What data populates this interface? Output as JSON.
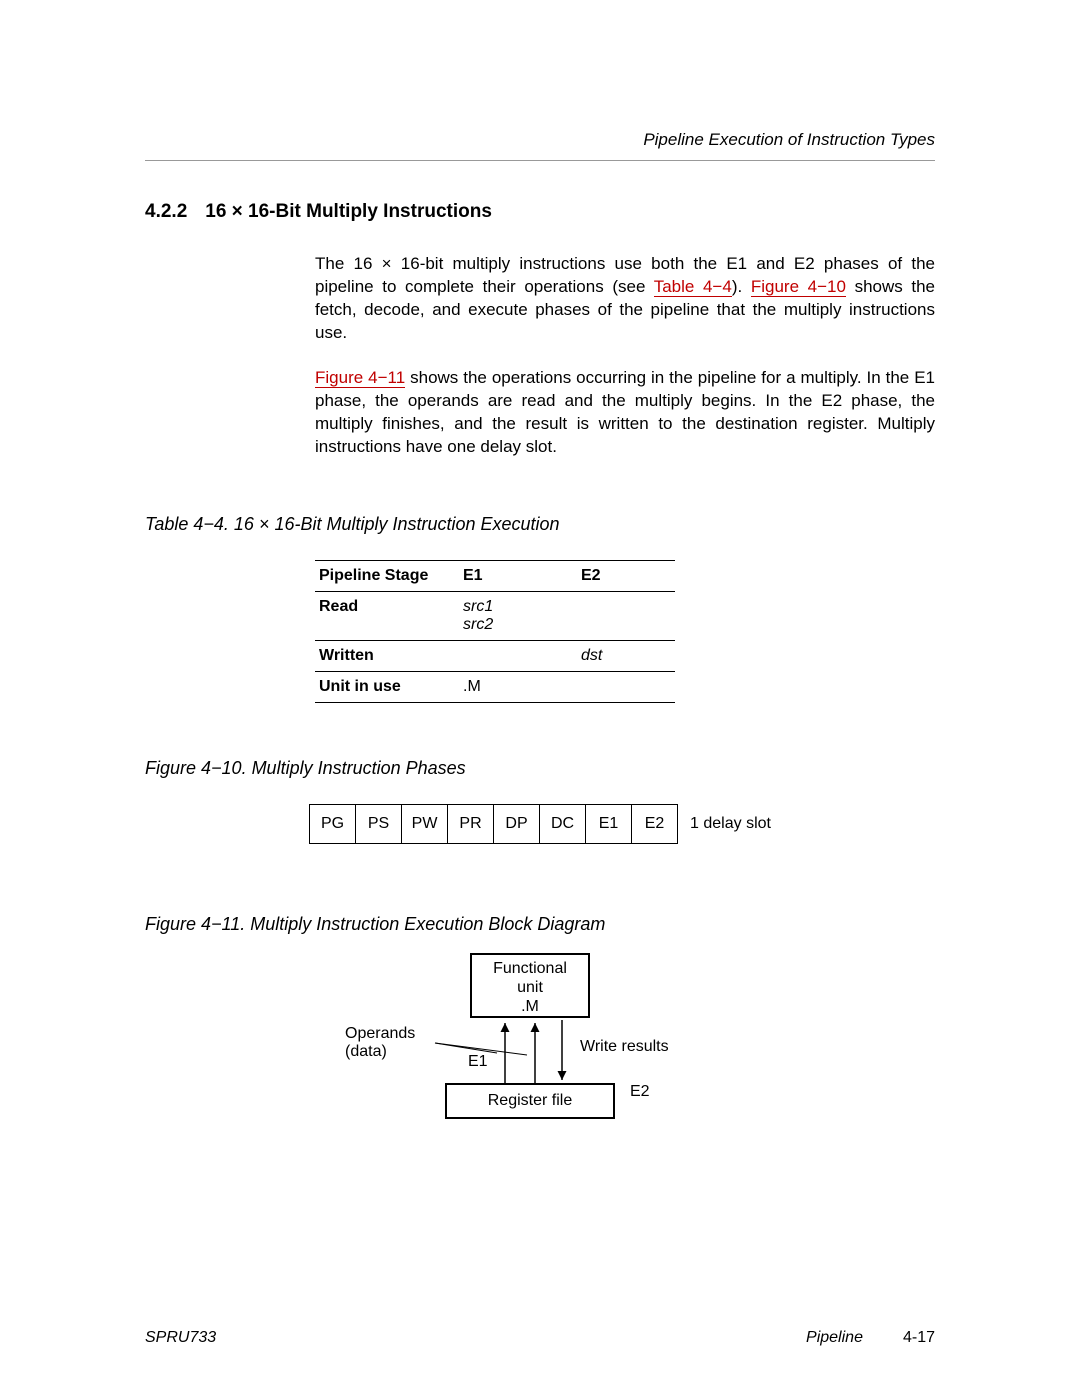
{
  "running_head": "Pipeline Execution of Instruction Types",
  "section": {
    "number": "4.2.2",
    "title": "16 × 16-Bit Multiply Instructions"
  },
  "para1": {
    "a": "The 16 × 16-bit multiply instructions use both the E1 and E2 phases of the pipeline to complete their operations (see ",
    "link1": "Table 4−4",
    "b": "). ",
    "link2": "Figure 4−10",
    "c": " shows the fetch, decode, and execute phases of the pipeline that the multiply instructions use."
  },
  "para2": {
    "link1": "Figure 4−11",
    "a": " shows the operations occurring in the pipeline for a multiply. In the E1 phase, the operands are read and the multiply begins. In the E2 phase, the multiply finishes, and the result is written to the destination register. Multiply instructions have one delay slot."
  },
  "table44": {
    "caption": "Table 4−4. 16 × 16-Bit Multiply Instruction Execution",
    "headers": {
      "c0": "Pipeline Stage",
      "c1": "E1",
      "c2": "E2"
    },
    "rows": [
      {
        "label": "Read",
        "e1a": "src1",
        "e1b": "src2",
        "e2": ""
      },
      {
        "label": "Written",
        "e1a": "",
        "e1b": "",
        "e2": "dst"
      },
      {
        "label": "Unit in use",
        "e1a": ".M",
        "e1b": "",
        "e2": ""
      }
    ]
  },
  "fig10": {
    "caption": "Figure 4−10. Multiply Instruction Phases",
    "phases": [
      "PG",
      "PS",
      "PW",
      "PR",
      "DP",
      "DC",
      "E1",
      "E2"
    ],
    "delay": "1 delay slot"
  },
  "fig11": {
    "caption": "Figure 4−11. Multiply Instruction Execution Block Diagram",
    "funit_line1": "Functional",
    "funit_line2": "unit",
    "funit_line3": ".M",
    "regfile": "Register file",
    "operands_l1": "Operands",
    "operands_l2": "(data)",
    "e1": "E1",
    "write": "Write results",
    "e2": "E2"
  },
  "footer": {
    "left": "SPRU733",
    "mid": "Pipeline",
    "page": "4-17"
  }
}
